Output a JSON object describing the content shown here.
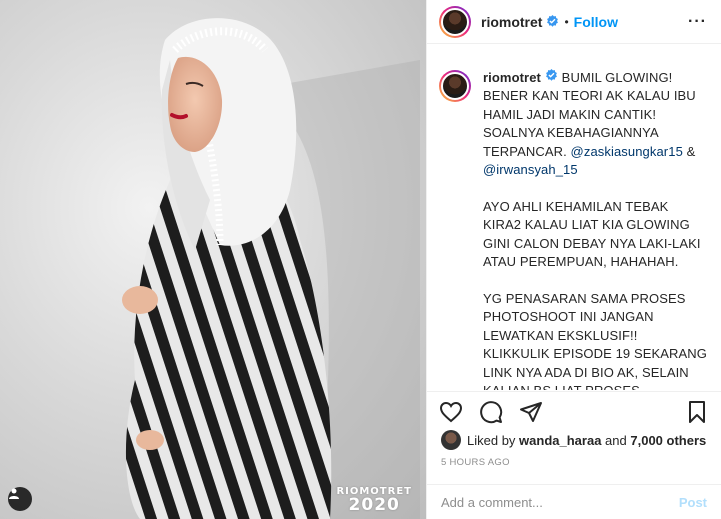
{
  "photo": {
    "watermark_name": "RIOMOTRET",
    "watermark_year": "2020",
    "user_tag_icon": "user-tag-icon"
  },
  "header": {
    "username": "riomotret",
    "separator": "•",
    "follow_label": "Follow",
    "more_label": "···",
    "verified_icon": "verified-badge-icon"
  },
  "caption": {
    "username": "riomotret",
    "text_1": " BUMIL GLOWING! BENER KAN TEORI AK KALAU IBU HAMIL JADI MAKIN CANTIK! SOALNYA KEBAHAGIANNYA TERPANCAR. ",
    "mention_1": "@zaskiasungkar15",
    "text_2": " & ",
    "mention_2": "@irwansyah_15",
    "text_3": "\n\nAYO AHLI KEHAMILAN TEBAK KIRA2 KALAU LIAT KIA GLOWING GINI CALON DEBAY NYA LAKI-LAKI ATAU PEREMPUAN, HAHAHAH.\n\nYG PENASARAN SAMA PROSES PHOTOSHOOT INI JANGAN LEWATKAN EKSKLUSIF!! KLIKKULIK EPISODE 19 SEKARANG LINK NYA ADA DI BIO AK, SELAIN KALIAN BS LIAT PROSES PHOTOSHOOT PASANGAN CUTE INI , ZASKIA &"
  },
  "actions": {
    "like_icon": "heart-icon",
    "comment_icon": "comment-icon",
    "share_icon": "share-icon",
    "save_icon": "bookmark-icon"
  },
  "likes": {
    "prefix": "Liked by ",
    "user": "wanda_haraa",
    "middle": " and ",
    "others": "7,000 others"
  },
  "timestamp": "5 HOURS AGO",
  "comment": {
    "placeholder": "Add a comment...",
    "post_label": "Post"
  },
  "colors": {
    "accent": "#0095f6",
    "mention": "#00376b",
    "muted": "#8e8e8e",
    "post_disabled": "#b2dffc"
  }
}
